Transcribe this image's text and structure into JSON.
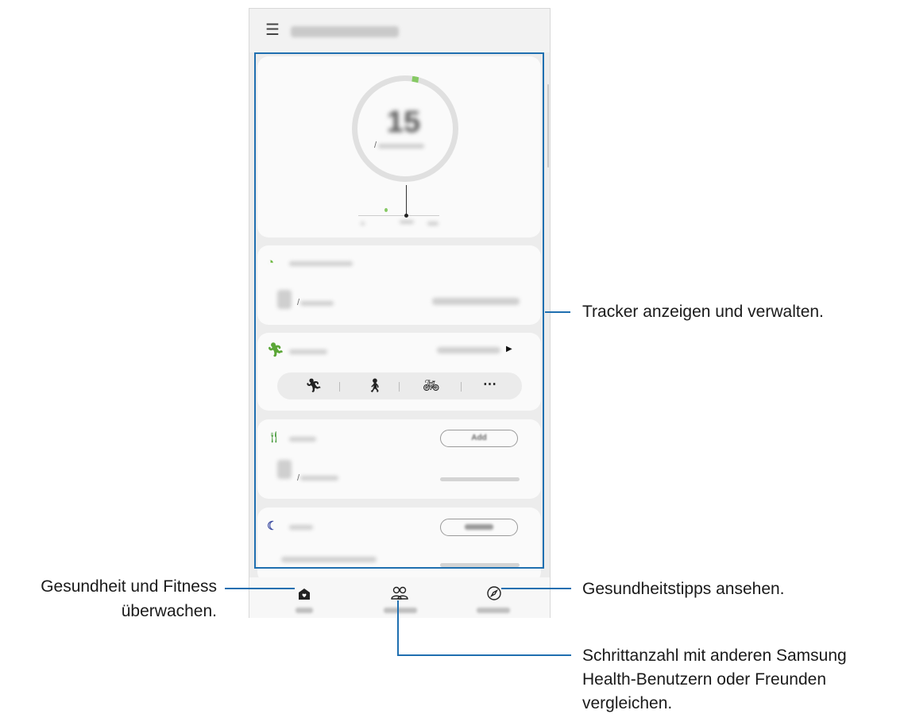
{
  "callouts": {
    "tracker": "Tracker anzeigen und verwalten.",
    "home_line1": "Gesundheit und Fitness",
    "home_line2": "überwachen.",
    "tips": "Gesundheitstipps ansehen.",
    "together_line1": "Schrittanzahl mit anderen Samsung",
    "together_line2": "Health-Benutzern oder Freunden",
    "together_line3": "vergleichen."
  },
  "app": {
    "menu_icon": "hamburger-icon",
    "steps_value": "15",
    "steps_slash": "/",
    "active_slash": "/",
    "food_slash": "/",
    "food_add_button": "Add"
  },
  "exercise_icons": [
    "run-icon",
    "walk-icon",
    "bike-icon",
    "more-icon"
  ],
  "nav": {
    "icons": [
      "home-icon",
      "together-icon",
      "discover-icon"
    ]
  },
  "colors": {
    "accent": "#1f6fb0",
    "green": "#86c964",
    "sleep": "#3a4aa0"
  }
}
